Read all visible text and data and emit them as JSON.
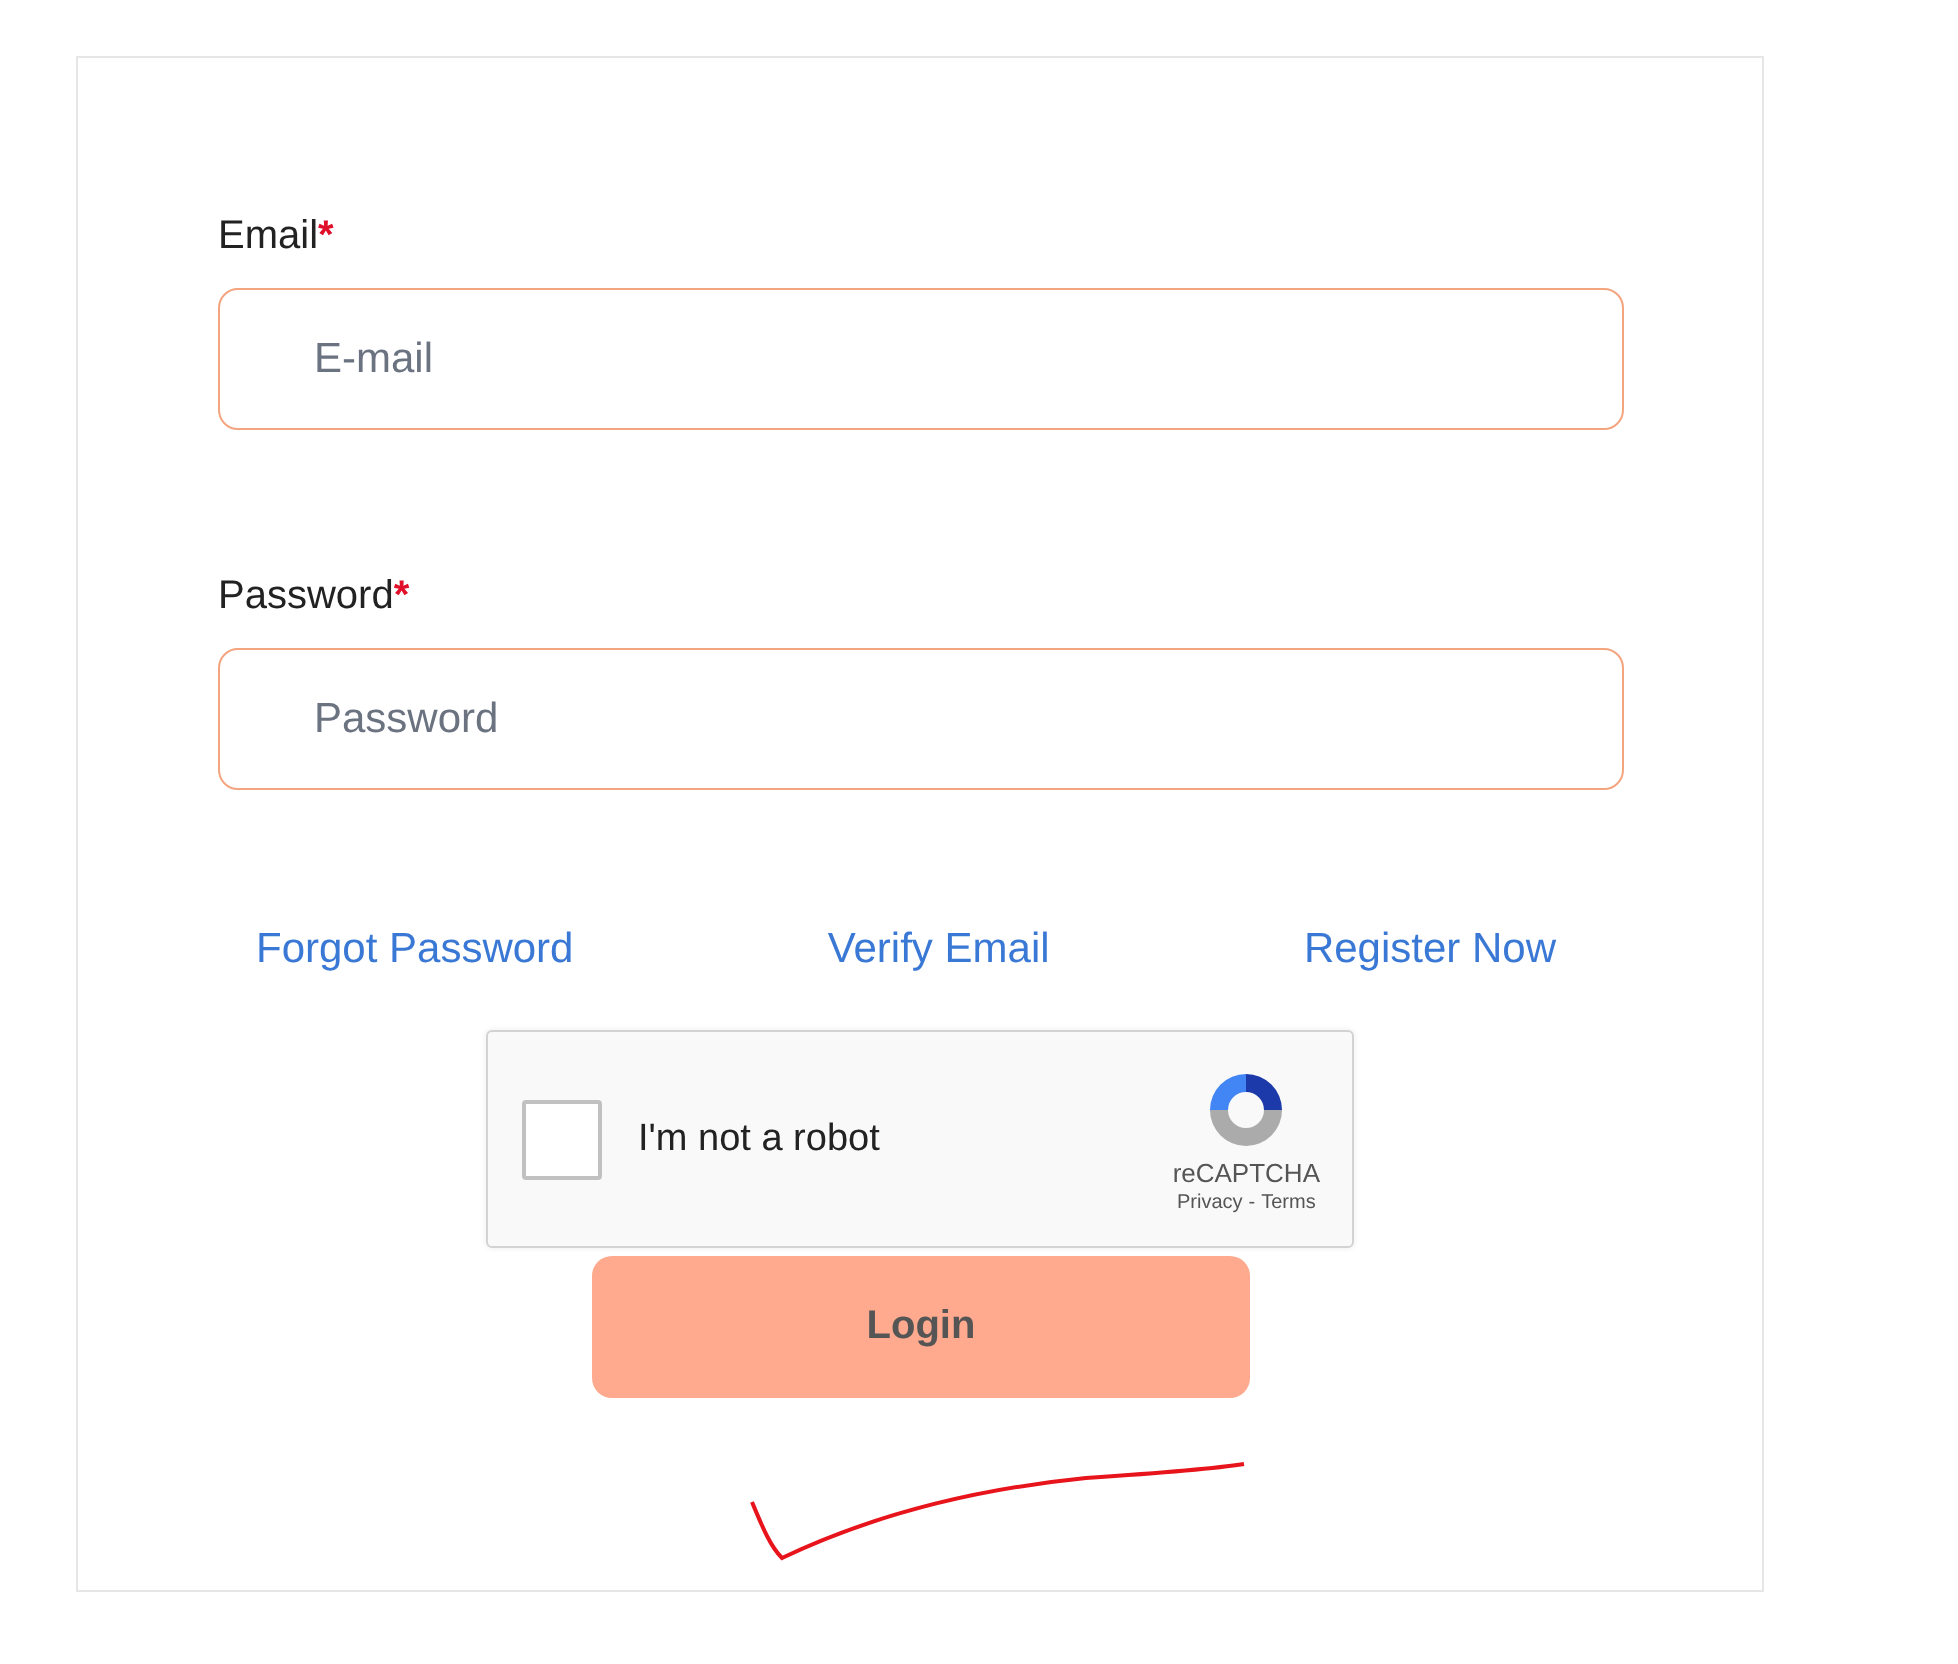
{
  "fields": [
    {
      "label": "Email",
      "required_mark": "*",
      "placeholder": "E-mail"
    },
    {
      "label": "Password",
      "required_mark": "*",
      "placeholder": "Password"
    }
  ],
  "links": [
    "Forgot Password",
    "Verify Email",
    "Register Now"
  ],
  "captcha": {
    "label": "I'm not a robot",
    "checked": false,
    "brand": "reCAPTCHA",
    "privacy": "Privacy",
    "separator": "-",
    "terms": "Terms"
  },
  "login_button": "Login"
}
